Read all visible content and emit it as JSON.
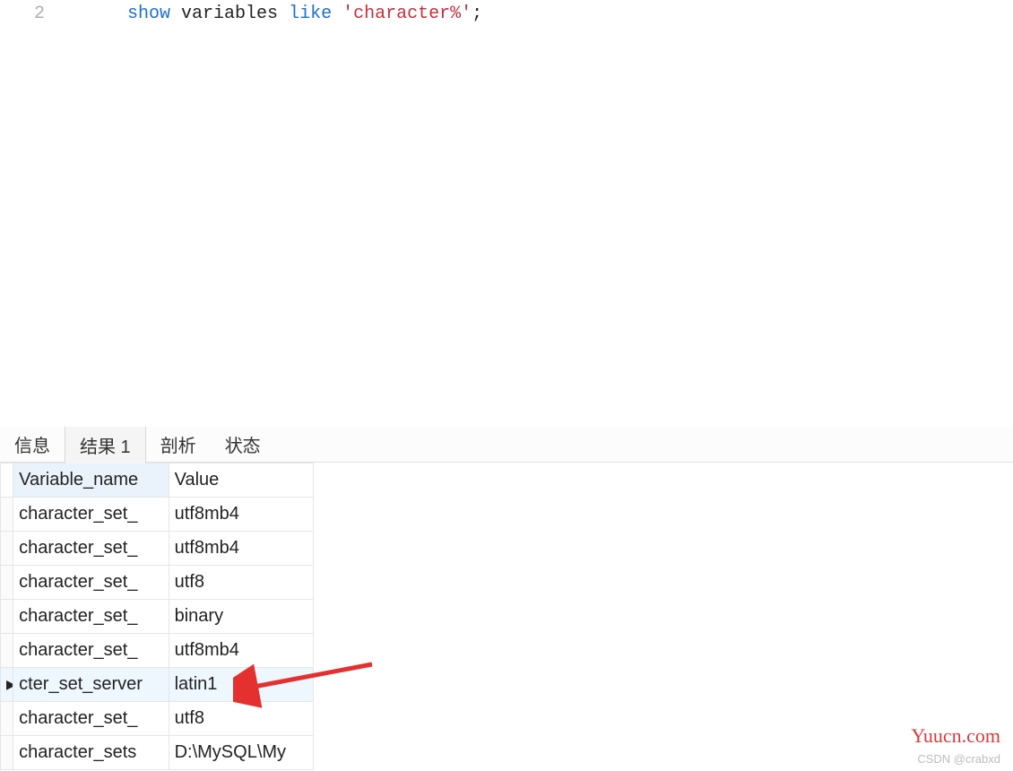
{
  "editor": {
    "line_number": "2",
    "sql": {
      "kw_show": "show",
      "ident_variables": " variables ",
      "kw_like": "like",
      "space": " ",
      "str_literal": "'character%'",
      "semicolon": ";"
    }
  },
  "tabs": {
    "info": "信息",
    "result1": "结果 1",
    "profile": "剖析",
    "status": "状态"
  },
  "results": {
    "headers": {
      "variable_name": "Variable_name",
      "value": "Value"
    },
    "rows": [
      {
        "marker": "",
        "variable_name": "character_set_",
        "value": "utf8mb4",
        "selected": false
      },
      {
        "marker": "",
        "variable_name": "character_set_",
        "value": "utf8mb4",
        "selected": false
      },
      {
        "marker": "",
        "variable_name": "character_set_",
        "value": "utf8",
        "selected": false
      },
      {
        "marker": "",
        "variable_name": "character_set_",
        "value": "binary",
        "selected": false
      },
      {
        "marker": "",
        "variable_name": "character_set_",
        "value": "utf8mb4",
        "selected": false
      },
      {
        "marker": "▶",
        "variable_name": "cter_set_server",
        "value": "latin1",
        "selected": true
      },
      {
        "marker": "",
        "variable_name": "character_set_",
        "value": "utf8",
        "selected": false
      },
      {
        "marker": "",
        "variable_name": "character_sets",
        "value": "D:\\MySQL\\My",
        "selected": false
      }
    ]
  },
  "watermarks": {
    "csdn": "CSDN @crabxd",
    "yuucn": "Yuucn.com"
  },
  "colors": {
    "keyword": "#1e6fcc",
    "string": "#c72e3a",
    "arrow": "#e53030",
    "selected_row_bg": "#eef6fe"
  }
}
